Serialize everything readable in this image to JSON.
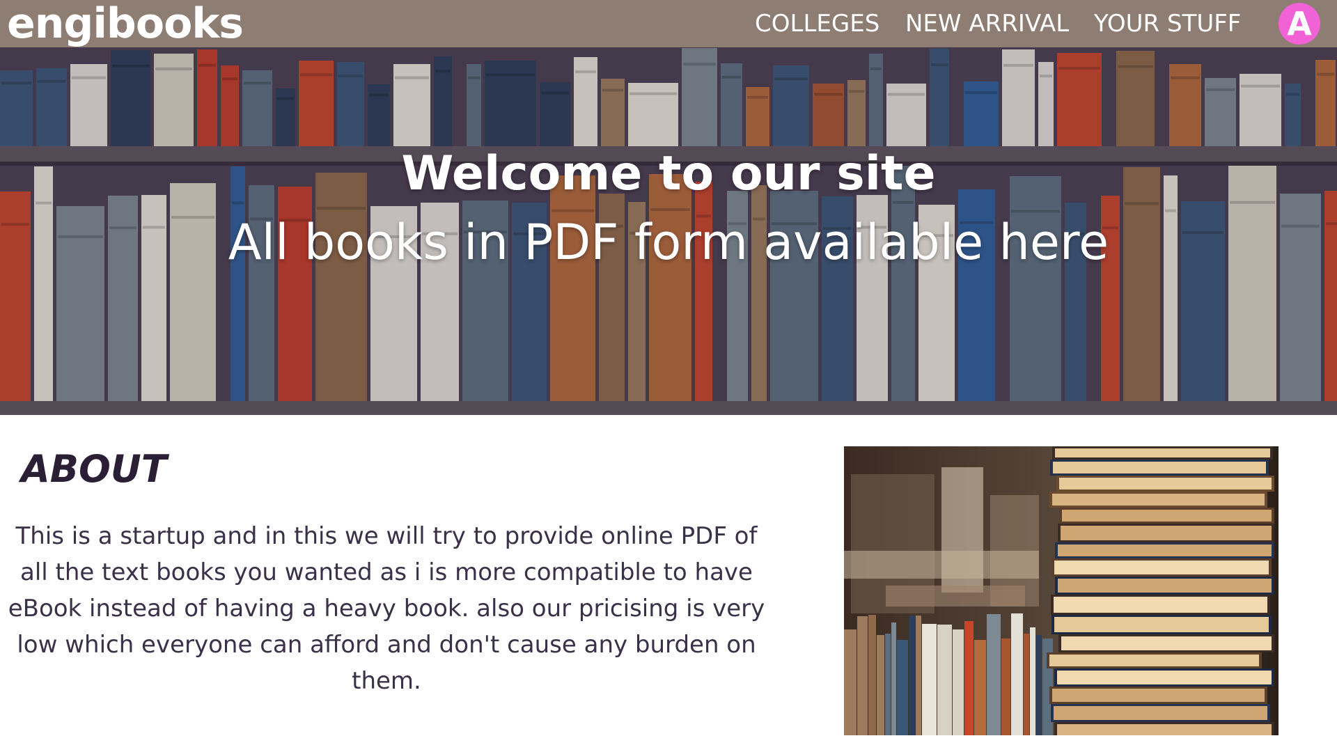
{
  "nav": {
    "logo": "engibooks",
    "links": [
      {
        "label": "COLLEGES"
      },
      {
        "label": "NEW ARRIVAL"
      },
      {
        "label": "YOUR STUFF"
      }
    ],
    "avatar_initial": "A"
  },
  "hero": {
    "title": "Welcome to our site",
    "subtitle": "All books in PDF form available here"
  },
  "about": {
    "heading": "ABOUT",
    "text": "This is a startup and in this we will try to provide online PDF of all the text books you wanted as i is more compatible to have eBook instead of having a heavy book. also our pricising is very low which everyone can afford and don't cause any burden on them."
  },
  "colors": {
    "nav_bg": "#8d7d72",
    "avatar_bg": "#f062d6",
    "heading": "#2b1f36",
    "text": "#3a3048"
  }
}
